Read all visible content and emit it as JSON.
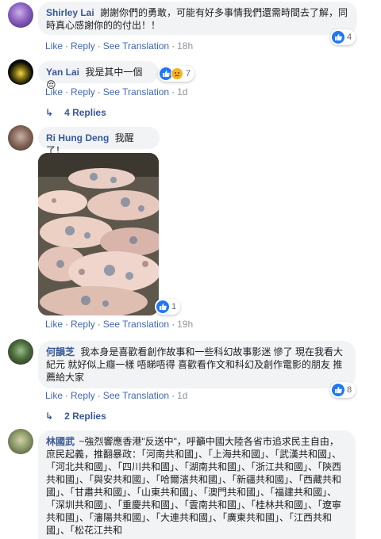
{
  "comments": [
    {
      "author": "Shirley Lai",
      "text": "謝謝你們的勇敢，可能有好多事情我們還需時間去了解，同時真心感謝你的的付出！！",
      "reaction_count": "4",
      "actions": {
        "like": "Like",
        "reply": "Reply",
        "translate": "See Translation",
        "time": "18h"
      }
    },
    {
      "author": "Yan Lai",
      "text": "我是其中一個😔",
      "reaction_count": "7",
      "actions": {
        "like": "Like",
        "reply": "Reply",
        "translate": "See Translation",
        "time": "1d"
      },
      "replies_label": "4 Replies"
    },
    {
      "author": "Ri Hung Deng",
      "text": "我醒了！",
      "reaction_count": "1",
      "actions": {
        "like": "Like",
        "reply": "Reply",
        "translate": "See Translation",
        "time": "19h"
      }
    },
    {
      "author": "何韻芝",
      "text": "我本身是喜歡看創作故事和一些科幻故事影迷 慘了 現在我看大紀元 就好似上癮一樣 唔睇唔得 喜歡看作文和科幻及創作電影的朋友 推薦給大家",
      "reaction_count": "8",
      "actions": {
        "like": "Like",
        "reply": "Reply",
        "translate": "See Translation",
        "time": "1d"
      },
      "replies_label": "2 Replies"
    },
    {
      "author": "林國武",
      "text": "~強烈響應香港\"反送中\"，呼籲中國大陸各省市追求民主自由，庶民起義，推翻暴政：「河南共和國」、「上海共和國」、「武漢共和國」、「河北共和國」、「四川共和國」、「湖南共和國」、「浙江共和國」、「陝西共和國」、「與安共和國」、「哈爾濱共和國」、「新疆共和國」、「西藏共和國」、「甘肅共和國」、「山東共和國」、「澳門共和國」、「福建共和國」、「深圳共和國」、「重慶共和國」、「雲南共和國」、「桂林共和國」、「遼寧共和國」、「瀋陽共和國」、「大連共和國」、「廣東共和國」、「江西共和國」、「松花江共和"
    }
  ],
  "colors": {
    "link": "#385898",
    "action": "#4267b2",
    "bubble": "#f2f3f5",
    "like": "#2078f4",
    "sad": "#f7b125"
  },
  "icons": {
    "like": "thumbs-up-icon",
    "sad": "sad-face-icon",
    "reply_arrow": "reply-arrow-icon"
  }
}
